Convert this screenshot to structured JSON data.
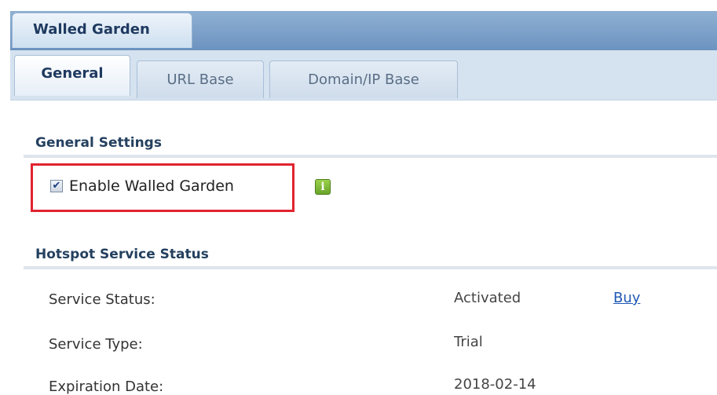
{
  "window": {
    "title": "Walled Garden"
  },
  "tabs": [
    {
      "label": "General"
    },
    {
      "label": "URL Base"
    },
    {
      "label": "Domain/IP Base"
    }
  ],
  "general_settings": {
    "title": "General Settings",
    "enable_label": "Enable Walled Garden",
    "enable_checked": true,
    "checkbox_glyph": "✔",
    "info_glyph": "i"
  },
  "hotspot_status": {
    "title": "Hotspot Service Status",
    "rows": [
      {
        "label": "Service Status:",
        "value": "Activated"
      },
      {
        "label": "Service Type:",
        "value": "Trial"
      },
      {
        "label": "Expiration Date:",
        "value": "2018-02-14"
      }
    ],
    "buy_label": "Buy"
  },
  "colors": {
    "header": "#7a9fca",
    "highlight": "#e0242f",
    "link": "#1f58b5",
    "info": "#7ab83a"
  }
}
